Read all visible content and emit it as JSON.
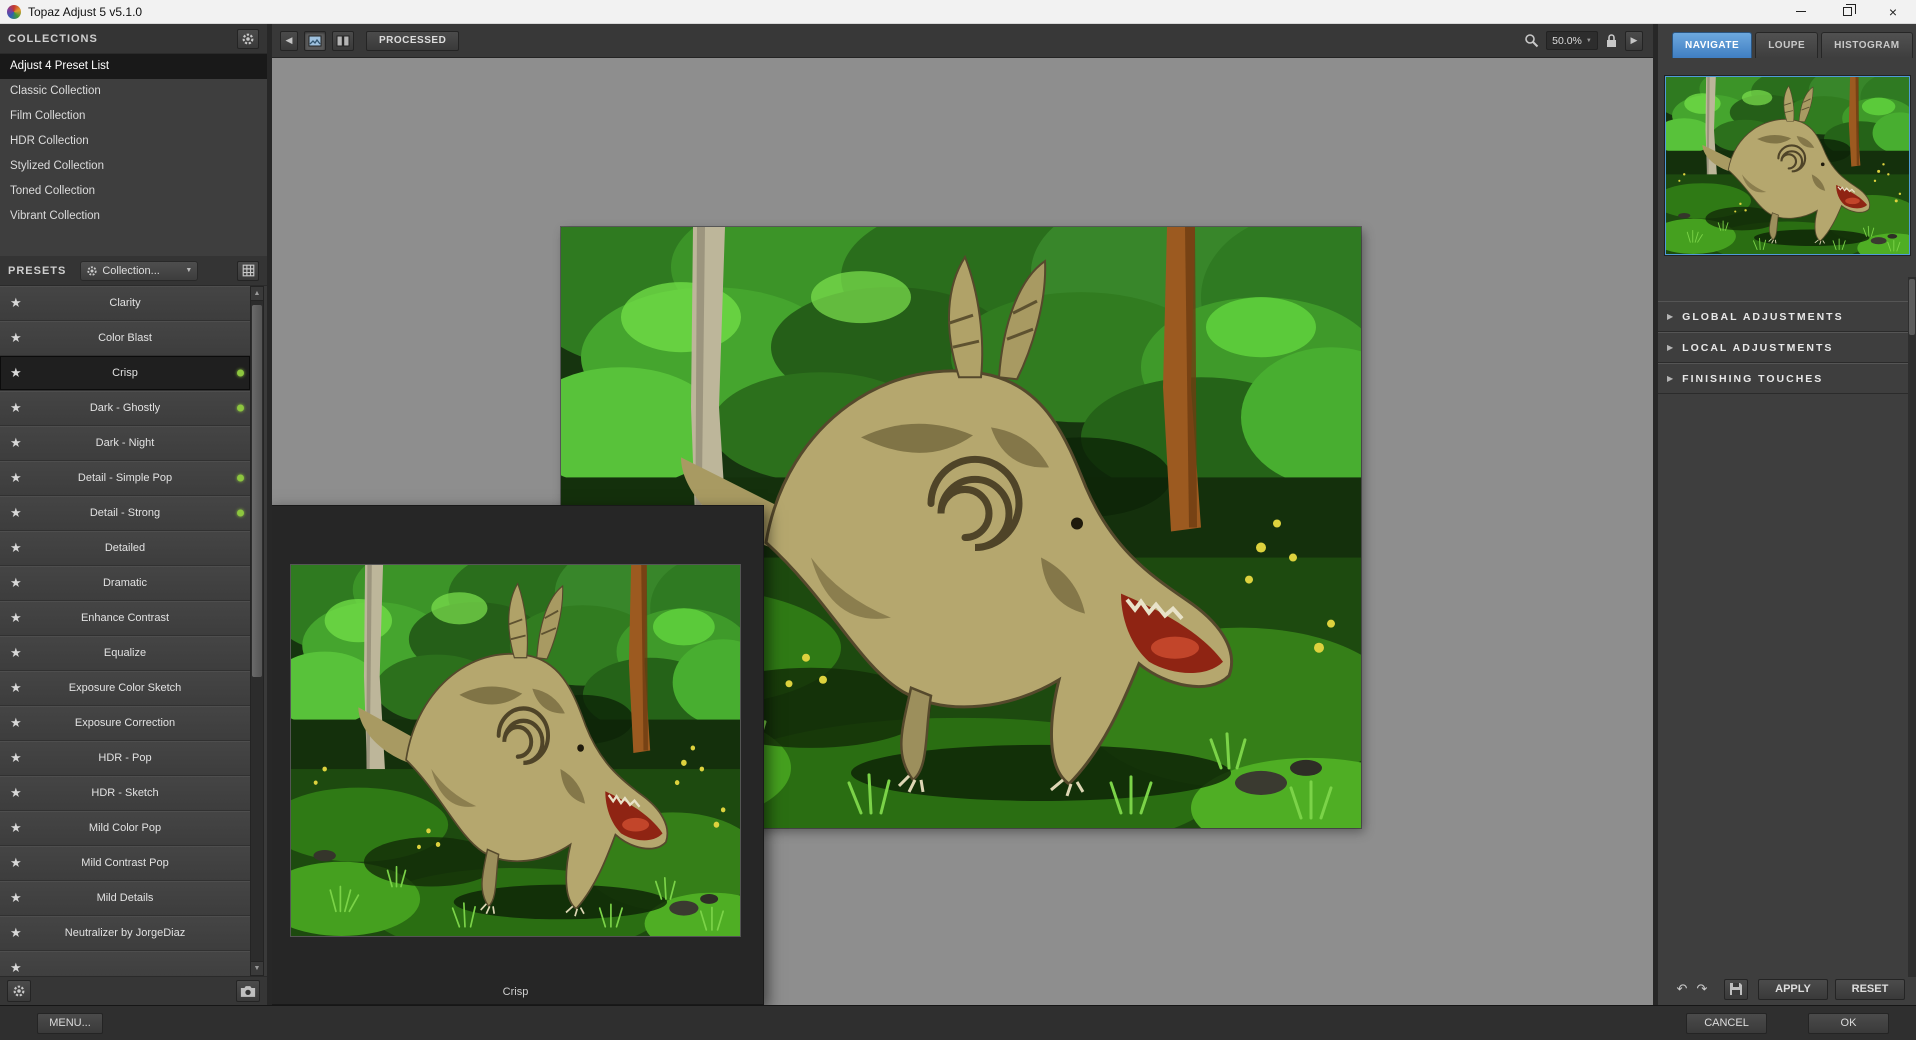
{
  "window": {
    "title": "Topaz Adjust 5 v5.1.0"
  },
  "collections": {
    "header": "COLLECTIONS",
    "items": [
      {
        "label": "Adjust 4 Preset List",
        "selected": true
      },
      {
        "label": "Classic Collection"
      },
      {
        "label": "Film Collection"
      },
      {
        "label": "HDR Collection"
      },
      {
        "label": "Stylized Collection"
      },
      {
        "label": "Toned Collection"
      },
      {
        "label": "Vibrant Collection"
      }
    ]
  },
  "presets": {
    "header": "PRESETS",
    "filter_label": "Collection...",
    "items": [
      {
        "label": "Clarity"
      },
      {
        "label": "Color Blast"
      },
      {
        "label": "Crisp",
        "selected": true,
        "dot": true
      },
      {
        "label": "Dark - Ghostly",
        "dot": true
      },
      {
        "label": "Dark - Night"
      },
      {
        "label": "Detail - Simple Pop",
        "dot": true
      },
      {
        "label": "Detail - Strong",
        "dot": true
      },
      {
        "label": "Detailed"
      },
      {
        "label": "Dramatic"
      },
      {
        "label": "Enhance Contrast"
      },
      {
        "label": "Equalize"
      },
      {
        "label": "Exposure Color Sketch"
      },
      {
        "label": "Exposure Correction"
      },
      {
        "label": "HDR - Pop"
      },
      {
        "label": "HDR - Sketch"
      },
      {
        "label": "Mild Color Pop"
      },
      {
        "label": "Mild Contrast Pop"
      },
      {
        "label": "Mild Details"
      },
      {
        "label": "Neutralizer by JorgeDiaz"
      }
    ]
  },
  "toolbar": {
    "processed_label": "PROCESSED",
    "zoom_value": "50.0%"
  },
  "preview": {
    "caption": "Crisp"
  },
  "right_panel": {
    "tabs": [
      {
        "label": "NAVIGATE",
        "active": true
      },
      {
        "label": "LOUPE"
      },
      {
        "label": "HISTOGRAM"
      }
    ],
    "sections": [
      {
        "label": "GLOBAL ADJUSTMENTS"
      },
      {
        "label": "LOCAL ADJUSTMENTS"
      },
      {
        "label": "FINISHING TOUCHES"
      }
    ],
    "apply_label": "APPLY",
    "reset_label": "RESET"
  },
  "bottom_bar": {
    "menu_label": "MENU...",
    "cancel_label": "CANCEL",
    "ok_label": "OK"
  },
  "icons": {
    "star": "★",
    "caret_down": "▼",
    "back": "◀",
    "forward": "▶",
    "section_expand": "▶",
    "undo": "↶",
    "redo": "↷",
    "scroll_up": "▲",
    "scroll_down": "▼",
    "close": "×"
  },
  "colors": {
    "accent_blue": "#4f9bd8",
    "panel_dark": "#3e3e3e",
    "canvas_gray": "#8e8e8e",
    "selected_dark": "#1f1f1f",
    "applied_dot_green": "#8dc63f"
  }
}
